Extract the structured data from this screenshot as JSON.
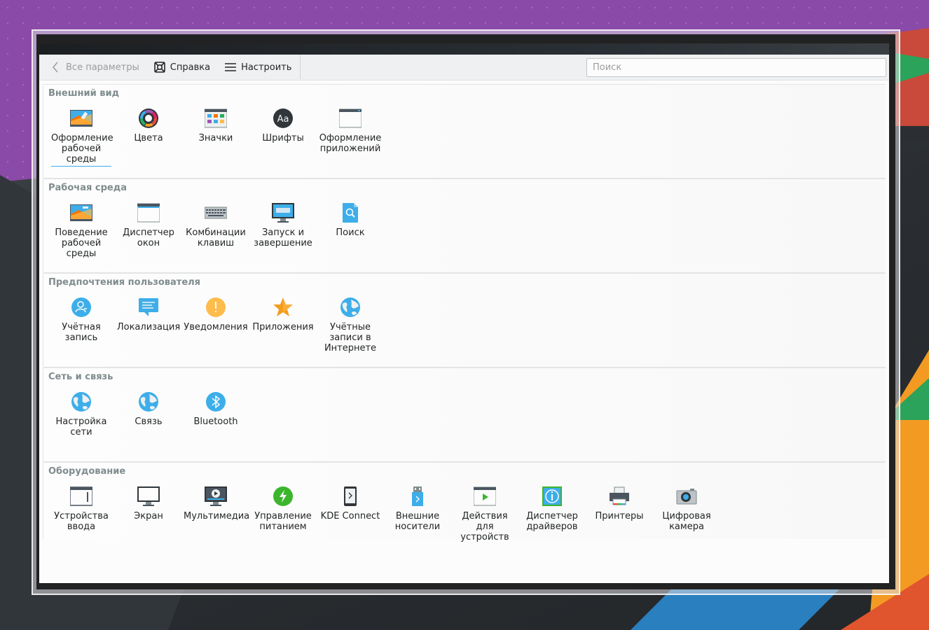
{
  "toolbar": {
    "back_label": "Все параметры",
    "help_label": "Справка",
    "configure_label": "Настроить",
    "search_placeholder": "Поиск"
  },
  "colors": {
    "accent": "#3daee9",
    "category_title": "#7f8c8d",
    "text": "#232627"
  },
  "categories": [
    {
      "title": "Внешний вид",
      "items": [
        {
          "label": "Оформление\nрабочей\nсреды",
          "icon": "workspace-theme-icon"
        },
        {
          "label": "Цвета",
          "icon": "colors-icon"
        },
        {
          "label": "Значки",
          "icon": "icons-icon"
        },
        {
          "label": "Шрифты",
          "icon": "fonts-icon"
        },
        {
          "label": "Оформление\nприложений",
          "icon": "application-style-icon"
        }
      ]
    },
    {
      "title": "Рабочая среда",
      "items": [
        {
          "label": "Поведение\nрабочей\nсреды",
          "icon": "workspace-behavior-icon"
        },
        {
          "label": "Диспетчер\nокон",
          "icon": "window-manager-icon"
        },
        {
          "label": "Комбинации\nклавиш",
          "icon": "keyboard-shortcuts-icon"
        },
        {
          "label": "Запуск и\nзавершение",
          "icon": "startup-shutdown-icon"
        },
        {
          "label": "Поиск",
          "icon": "search-settings-icon"
        }
      ]
    },
    {
      "title": "Предпочтения пользователя",
      "items": [
        {
          "label": "Учётная\nзапись",
          "icon": "user-account-icon"
        },
        {
          "label": "Локализация",
          "icon": "localization-icon"
        },
        {
          "label": "Уведомления",
          "icon": "notifications-icon"
        },
        {
          "label": "Приложения",
          "icon": "applications-star-icon"
        },
        {
          "label": "Учётные\nзаписи в\nИнтернете",
          "icon": "online-accounts-icon"
        }
      ]
    },
    {
      "title": "Сеть и связь",
      "items": [
        {
          "label": "Настройка\nсети",
          "icon": "network-settings-icon"
        },
        {
          "label": "Связь",
          "icon": "connectivity-icon"
        },
        {
          "label": "Bluetooth",
          "icon": "bluetooth-icon"
        }
      ]
    },
    {
      "title": "Оборудование",
      "items": [
        {
          "label": "Устройства\nввода",
          "icon": "input-devices-icon"
        },
        {
          "label": "Экран",
          "icon": "display-icon"
        },
        {
          "label": "Мультимедиа",
          "icon": "multimedia-icon"
        },
        {
          "label": "Управление\nпитанием",
          "icon": "power-management-icon"
        },
        {
          "label": "KDE Connect",
          "icon": "kde-connect-icon"
        },
        {
          "label": "Внешние\nносители",
          "icon": "removable-storage-icon"
        },
        {
          "label": "Действия для\nустройств",
          "icon": "device-actions-icon"
        },
        {
          "label": "Диспетчер\nдрайверов",
          "icon": "driver-manager-icon"
        },
        {
          "label": "Принтеры",
          "icon": "printers-icon"
        },
        {
          "label": "Цифровая\nкамера",
          "icon": "digital-camera-icon"
        }
      ]
    }
  ]
}
